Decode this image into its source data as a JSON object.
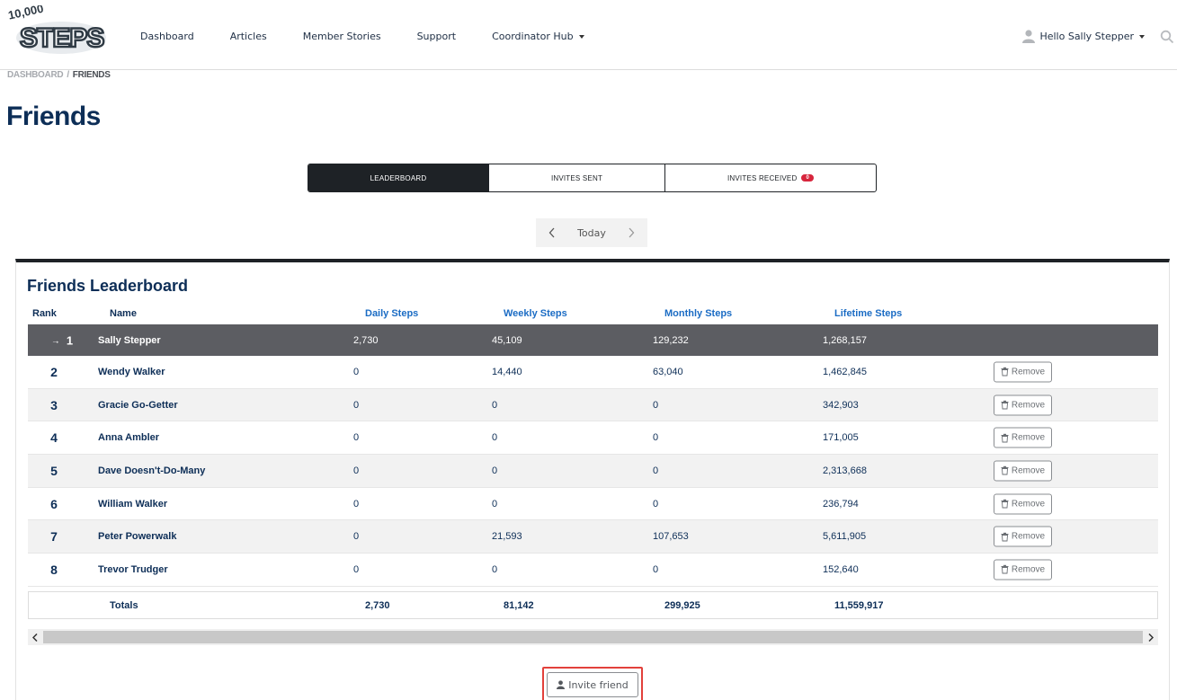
{
  "header": {
    "logo_text": "10,000 STEPS",
    "nav": [
      {
        "label": "Dashboard"
      },
      {
        "label": "Articles"
      },
      {
        "label": "Member Stories"
      },
      {
        "label": "Support"
      },
      {
        "label": "Coordinator Hub"
      }
    ],
    "user_greeting": "Hello Sally Stepper"
  },
  "breadcrumb": {
    "root": "DASHBOARD",
    "separator": "/",
    "current": "FRIENDS"
  },
  "page_title": "Friends",
  "tabs": [
    {
      "label": "LEADERBOARD",
      "active": true
    },
    {
      "label": "INVITES SENT",
      "active": false
    },
    {
      "label": "INVITES RECEIVED",
      "active": false,
      "badge": "0"
    }
  ],
  "pager": {
    "label": "Today"
  },
  "leaderboard": {
    "title": "Friends Leaderboard",
    "headers": {
      "rank": "Rank",
      "name": "Name",
      "daily": "Daily Steps",
      "weekly": "Weekly Steps",
      "monthly": "Monthly Steps",
      "lifetime": "Lifetime Steps"
    },
    "rows": [
      {
        "rank": "1",
        "name": "Sally Stepper",
        "daily": "2,730",
        "weekly": "45,109",
        "monthly": "129,232",
        "lifetime": "1,268,157"
      },
      {
        "rank": "2",
        "name": "Wendy Walker",
        "daily": "0",
        "weekly": "14,440",
        "monthly": "63,040",
        "lifetime": "1,462,845",
        "action": "Remove"
      },
      {
        "rank": "3",
        "name": "Gracie Go-Getter",
        "daily": "0",
        "weekly": "0",
        "monthly": "0",
        "lifetime": "342,903",
        "action": "Remove"
      },
      {
        "rank": "4",
        "name": "Anna Ambler",
        "daily": "0",
        "weekly": "0",
        "monthly": "0",
        "lifetime": "171,005",
        "action": "Remove"
      },
      {
        "rank": "5",
        "name": "Dave Doesn't-Do-Many",
        "daily": "0",
        "weekly": "0",
        "monthly": "0",
        "lifetime": "2,313,668",
        "action": "Remove"
      },
      {
        "rank": "6",
        "name": "William Walker",
        "daily": "0",
        "weekly": "0",
        "monthly": "0",
        "lifetime": "236,794",
        "action": "Remove"
      },
      {
        "rank": "7",
        "name": "Peter Powerwalk",
        "daily": "0",
        "weekly": "21,593",
        "monthly": "107,653",
        "lifetime": "5,611,905",
        "action": "Remove"
      },
      {
        "rank": "8",
        "name": "Trevor Trudger",
        "daily": "0",
        "weekly": "0",
        "monthly": "0",
        "lifetime": "152,640",
        "action": "Remove"
      }
    ],
    "totals": {
      "label": "Totals",
      "daily": "2,730",
      "weekly": "81,142",
      "monthly": "299,925",
      "lifetime": "11,559,917"
    }
  },
  "invite_button_label": "Invite friend",
  "colors": {
    "brand_navy": "#0d2e57",
    "link_blue": "#1b6cc4",
    "dark": "#1e2226",
    "highlight_row": "#5c5d62",
    "badge_red": "#d7263d",
    "focus_outline": "#e2413b"
  }
}
